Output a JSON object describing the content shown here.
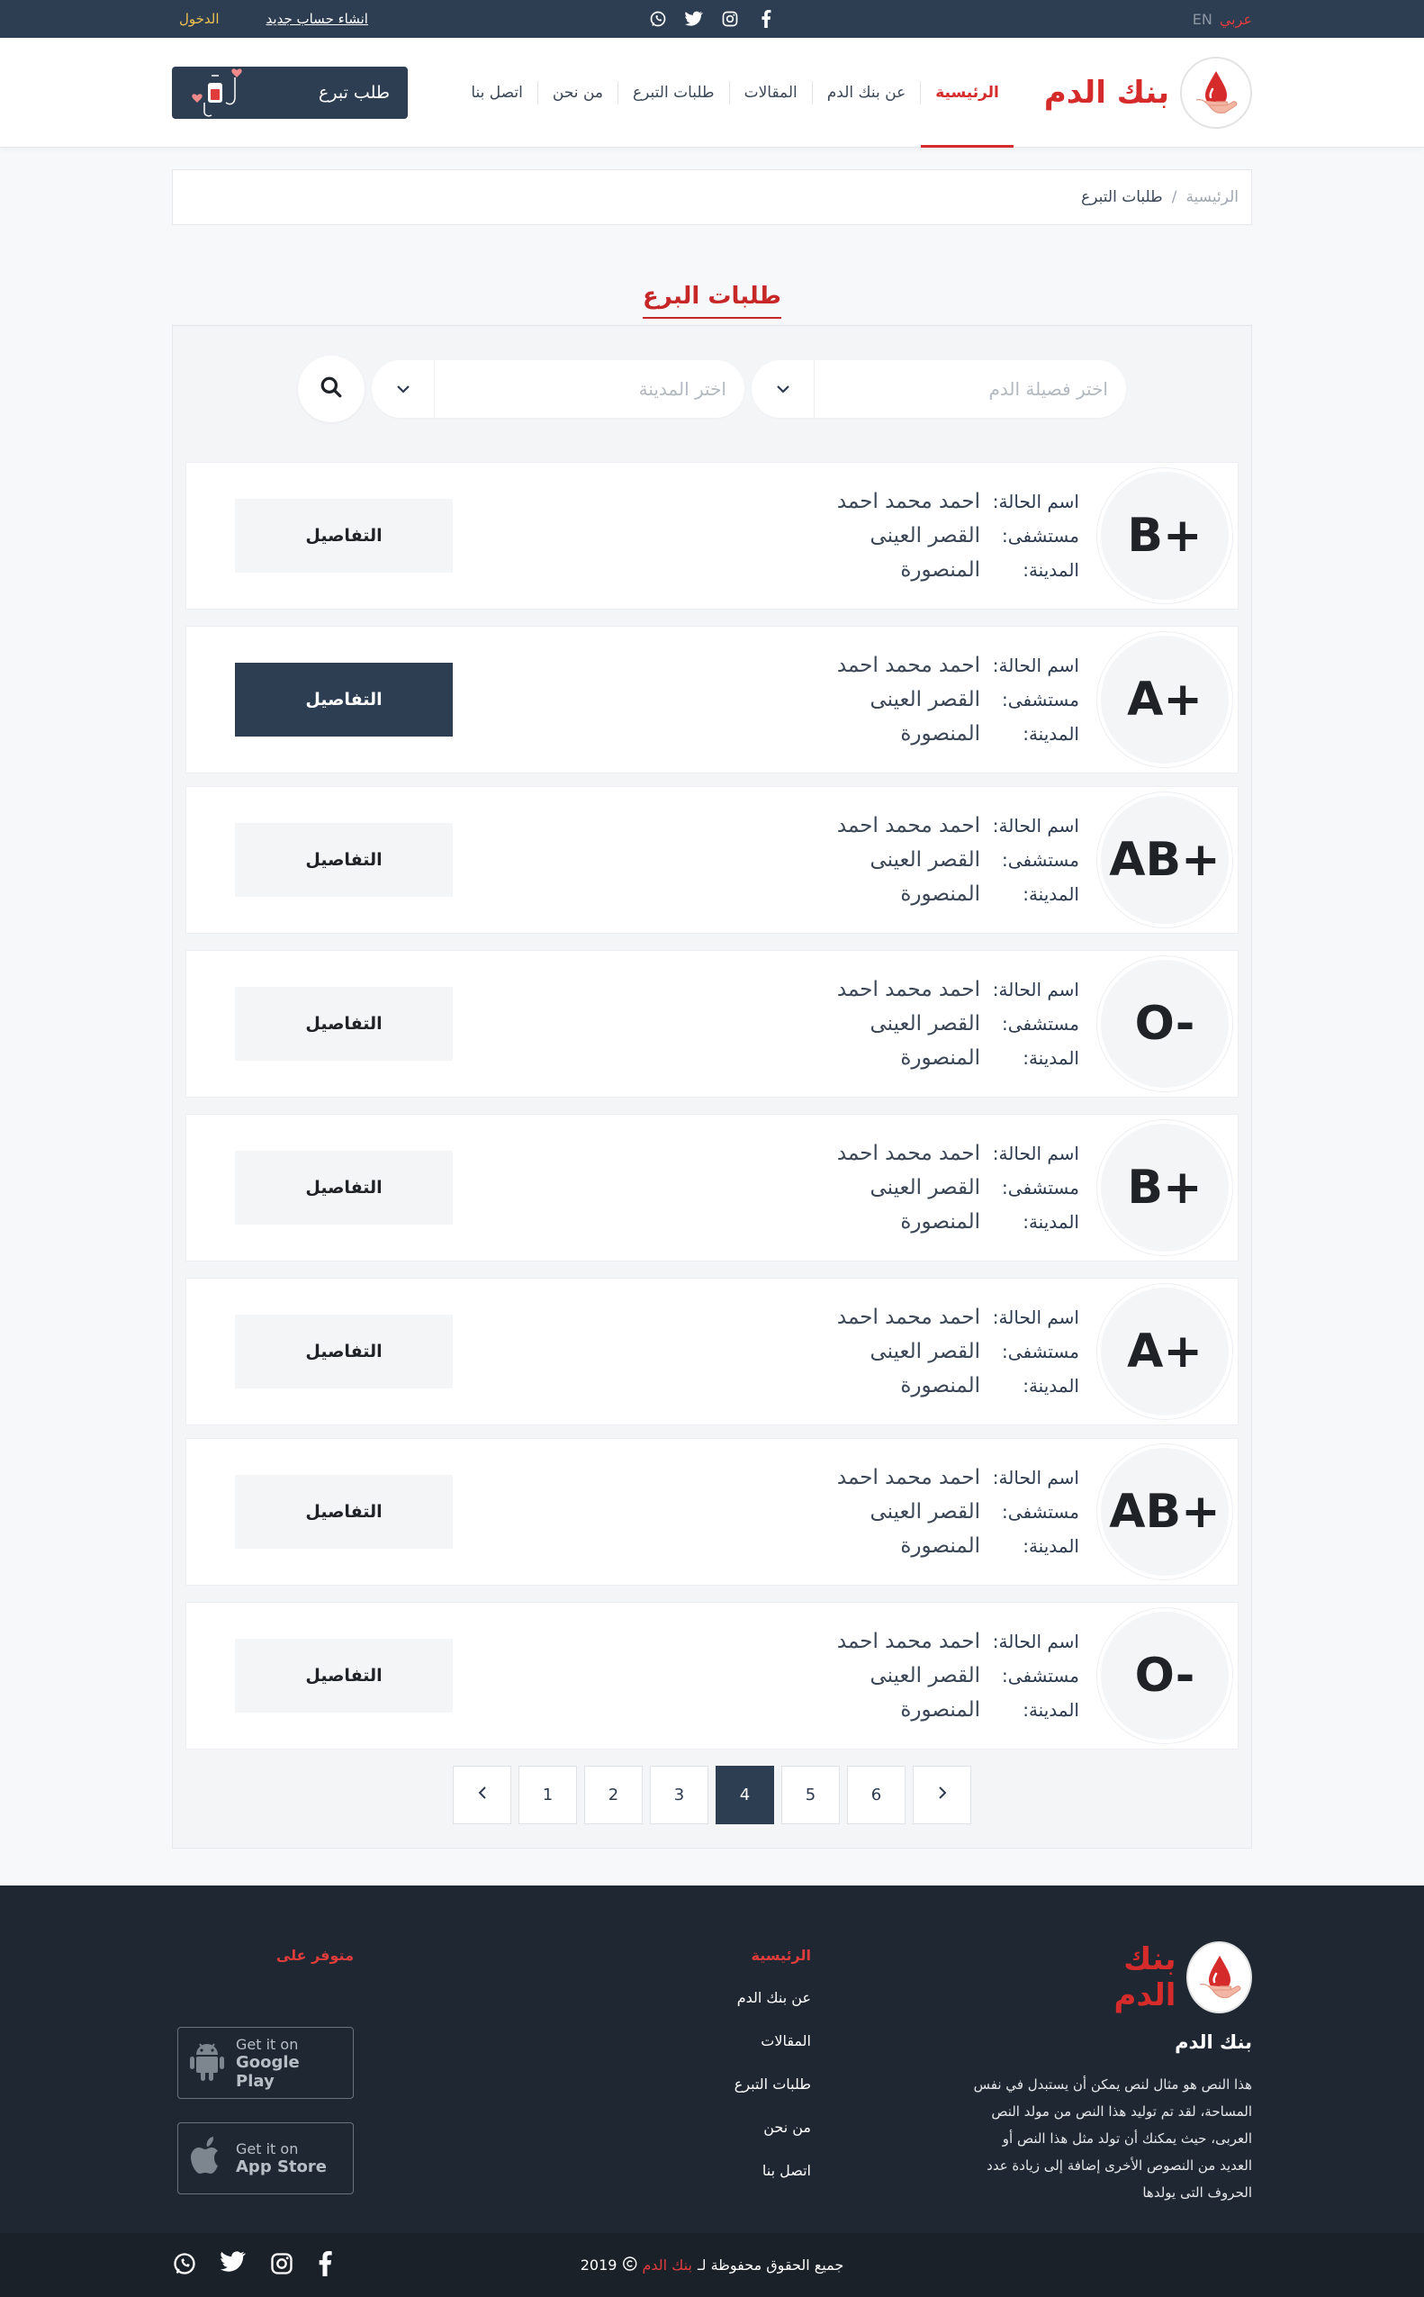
{
  "topbar": {
    "lang_ar": "عربي",
    "lang_en": "EN",
    "login": "الدخول",
    "register": "انشاء حساب جديد"
  },
  "header": {
    "brand_name": "بنك الدم",
    "donate_button": "طلب تبرع",
    "nav": [
      {
        "label": "الرئيسية"
      },
      {
        "label": "عن بنك الدم"
      },
      {
        "label": "المقالات"
      },
      {
        "label": "طلبات التبرع"
      },
      {
        "label": "من نحن"
      },
      {
        "label": "اتصل بنا"
      }
    ]
  },
  "breadcrumb": {
    "home": "الرئيسية",
    "separator": "/",
    "current": "طلبات التبرع"
  },
  "section_title": "طلبات البرع",
  "filters": {
    "blood_placeholder": "اختر فصيلة الدم",
    "city_placeholder": "اختر المدينة"
  },
  "labels": {
    "name": "اسم الحالة:",
    "hospital": "مستشفى:",
    "city": "المدينة:",
    "details": "التفاصيل"
  },
  "requests": [
    {
      "blood": "B+",
      "name": "احمد محمد احمد",
      "hospital": "القصر العينى",
      "city": "المنصورة"
    },
    {
      "blood": "A+",
      "name": "احمد محمد احمد",
      "hospital": "القصر العينى",
      "city": "المنصورة"
    },
    {
      "blood": "AB+",
      "name": "احمد محمد احمد",
      "hospital": "القصر العينى",
      "city": "المنصورة"
    },
    {
      "blood": "O-",
      "name": "احمد محمد احمد",
      "hospital": "القصر العينى",
      "city": "المنصورة"
    },
    {
      "blood": "B+",
      "name": "احمد محمد احمد",
      "hospital": "القصر العينى",
      "city": "المنصورة"
    },
    {
      "blood": "A+",
      "name": "احمد محمد احمد",
      "hospital": "القصر العينى",
      "city": "المنصورة"
    },
    {
      "blood": "AB+",
      "name": "احمد محمد احمد",
      "hospital": "القصر العينى",
      "city": "المنصورة"
    },
    {
      "blood": "O-",
      "name": "احمد محمد احمد",
      "hospital": "القصر العينى",
      "city": "المنصورة"
    }
  ],
  "pagination": {
    "pages": [
      "1",
      "2",
      "3",
      "4",
      "5",
      "6"
    ],
    "current": "4"
  },
  "footer": {
    "brand_name": "بنك الدم",
    "about_title": "بنك الدم",
    "about_text": "هذا النص هو مثال لنص يمكن أن يستبدل في نفس المساحة، لقد تم توليد هذا النص من مولد النص العربى، حيث يمكنك أن تولد مثل هذا النص أو العديد من النصوص الأخرى إضافة إلى زيادة عدد الحروف التى يولدها",
    "links": [
      "الرئيسية",
      "عن بنك الدم",
      "المقالات",
      "طلبات التبرع",
      "من نحن",
      "اتصل بنا"
    ],
    "available_on": "متوفر على",
    "google_small": "Get it on",
    "google_big": "Google Play",
    "apple_small": "Get it on",
    "apple_big": "App Store",
    "copyright_text": "جميع الحقوق محفوظة لـ",
    "copyright_brand": "بنك الدم",
    "copyright_year": "2019"
  },
  "colors": {
    "accent": "#d62b2b",
    "navy": "#2d3e52",
    "footer": "#1f2832"
  }
}
